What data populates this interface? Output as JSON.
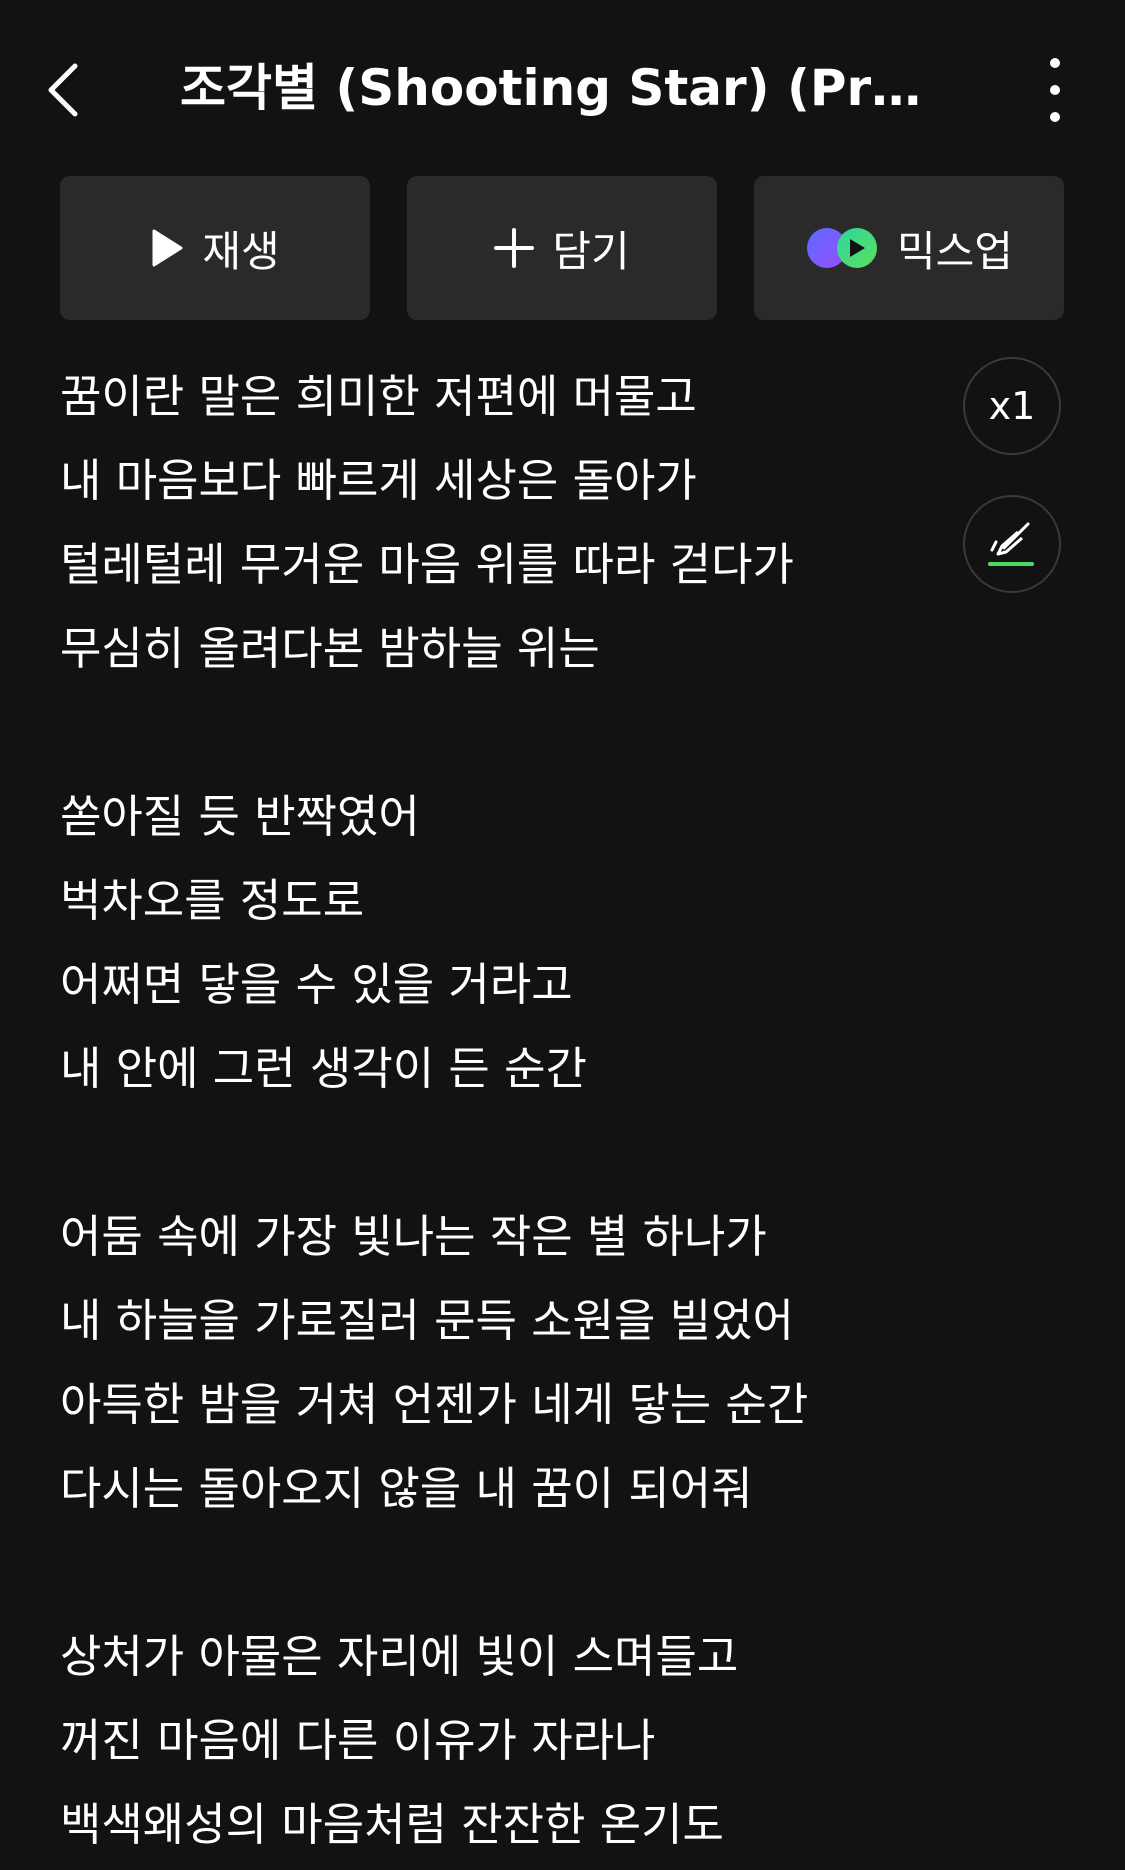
{
  "header": {
    "title": "조각별 (Shooting Star) (Pro..."
  },
  "actions": {
    "play_label": "재생",
    "add_label": "담기",
    "mixup_label": "믹스업"
  },
  "controls": {
    "speed_label": "x1"
  },
  "colors": {
    "background": "#121212",
    "button_bg": "#2a2a2a",
    "highlight_accent": "#4cd964",
    "mixup_purple": "#7b5cff",
    "mixup_green": "#3ad16b"
  },
  "icons": {
    "back": "chevron-left-icon",
    "more": "more-vertical-icon",
    "play": "play-icon",
    "add": "plus-icon",
    "mixup": "mixup-logo-icon",
    "highlight": "highlighter-icon"
  },
  "lyrics": [
    "꿈이란 말은 희미한 저편에 머물고",
    "내 마음보다 빠르게 세상은 돌아가",
    "털레털레 무거운 마음 위를 따라 걷다가",
    "무심히 올려다본 밤하늘 위는",
    "",
    "쏟아질 듯 반짝였어",
    "벅차오를 정도로",
    "어쩌면 닿을 수 있을 거라고",
    "내 안에 그런 생각이 든 순간",
    "",
    "어둠 속에 가장 빛나는 작은 별 하나가",
    "내 하늘을 가로질러 문득 소원을 빌었어",
    "아득한 밤을 거쳐 언젠가 네게 닿는 순간",
    "다시는 돌아오지 않을 내 꿈이 되어줘",
    "",
    "상처가 아물은 자리에 빛이 스며들고",
    "꺼진 마음에 다른 이유가 자라나",
    "백색왜성의 마음처럼 잔잔한 온기도"
  ]
}
